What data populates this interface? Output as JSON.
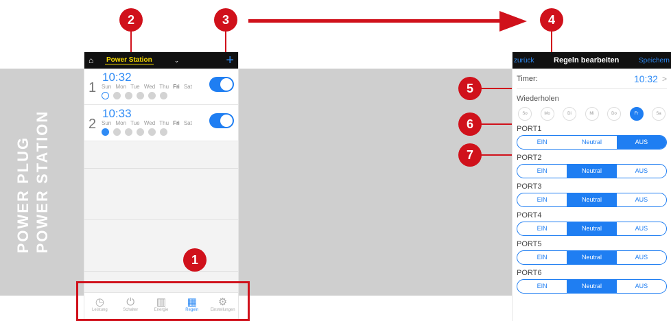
{
  "side_text": {
    "line1": "POWER PLUG",
    "line2": "POWER STATION"
  },
  "badges": [
    "1",
    "2",
    "3",
    "4",
    "5",
    "6",
    "7"
  ],
  "left_phone": {
    "home_icon": "home-icon",
    "station_name": "Power Station",
    "caret": "⌄",
    "plus": "+",
    "rules": [
      {
        "num": "1",
        "time": "10:32",
        "days": [
          "Sun",
          "Mon",
          "Tue",
          "Wed",
          "Thu",
          "Fri",
          "Sat"
        ],
        "first_dot": "EIN",
        "enabled": true
      },
      {
        "num": "2",
        "time": "10:33",
        "days": [
          "Sun",
          "Mon",
          "Tue",
          "Wed",
          "Thu",
          "Fri",
          "Sat"
        ],
        "first_dot": "EIN",
        "enabled": true
      }
    ],
    "tabs": [
      {
        "icon": "◷",
        "icon_name": "gauge-icon",
        "label": "Leistung"
      },
      {
        "icon": "⏻",
        "icon_name": "power-icon",
        "label": "Schalter"
      },
      {
        "icon": "▥",
        "icon_name": "bar-chart-icon",
        "label": "Energie"
      },
      {
        "icon": "▦",
        "icon_name": "calendar-clock-icon",
        "label": "Regeln",
        "active": true
      },
      {
        "icon": "⚙",
        "icon_name": "gear-icon",
        "label": "Einstellungen"
      }
    ]
  },
  "right_phone": {
    "back": "zurück",
    "title": "Regeln bearbeiten",
    "save": "Speichern",
    "timer_label": "Timer:",
    "timer_value": "10:32",
    "timer_chevron": ">",
    "repeat_label": "Wiederholen",
    "weekdays": [
      "So",
      "Mo",
      "Di",
      "Mi",
      "Do",
      "Fr",
      "Sa"
    ],
    "selected_weekday": "Fr",
    "options": [
      "EIN",
      "Neutral",
      "AUS"
    ],
    "ports": [
      {
        "label": "PORT1",
        "selected": "AUS"
      },
      {
        "label": "PORT2",
        "selected": "Neutral"
      },
      {
        "label": "PORT3",
        "selected": "Neutral"
      },
      {
        "label": "PORT4",
        "selected": "Neutral"
      },
      {
        "label": "PORT5",
        "selected": "Neutral"
      },
      {
        "label": "PORT6",
        "selected": "Neutral"
      }
    ]
  },
  "colors": {
    "accent": "#d0111b",
    "blue": "#1f7ef2",
    "band": "#cfcfcf",
    "yellow": "#f5d800"
  }
}
